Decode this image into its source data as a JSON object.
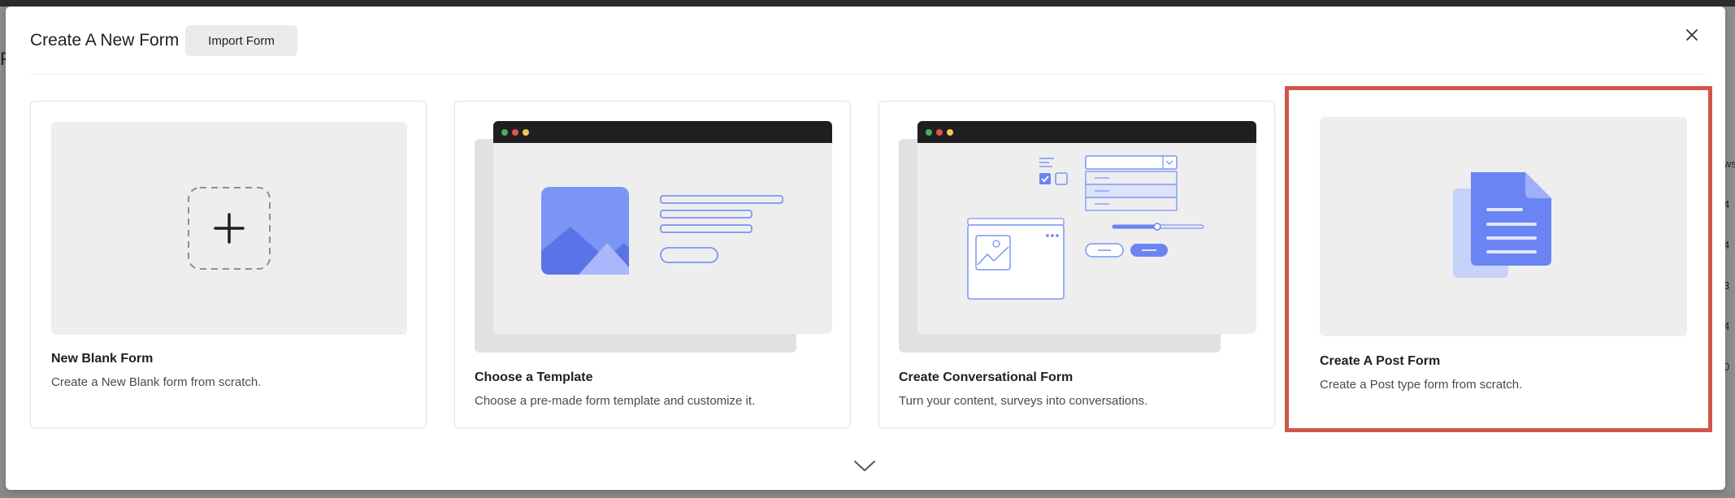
{
  "modal": {
    "title": "Create A New Form",
    "import_label": "Import Form"
  },
  "cards": [
    {
      "title": "New Blank Form",
      "description": "Create a New Blank form from scratch."
    },
    {
      "title": "Choose a Template",
      "description": "Choose a pre-made form template and customize it."
    },
    {
      "title": "Create Conversational Form",
      "description": "Turn your content, surveys into conversations."
    },
    {
      "title": "Create A Post Form",
      "description": "Create a Post type form from scratch."
    }
  ],
  "background": {
    "left_edge_text": "Fo",
    "right_edge_header": "ws",
    "right_edge_values": [
      "4",
      "4",
      "3",
      "4",
      "0"
    ]
  },
  "colors": {
    "accent": "#6a84f3",
    "accent_light": "#c7d2fb",
    "highlight": "#d0564a"
  },
  "icons": [
    "close-icon",
    "plus-icon",
    "image-icon",
    "checkbox-icon",
    "dropdown-icon",
    "slider-icon",
    "document-icon",
    "chevron-down-icon"
  ]
}
